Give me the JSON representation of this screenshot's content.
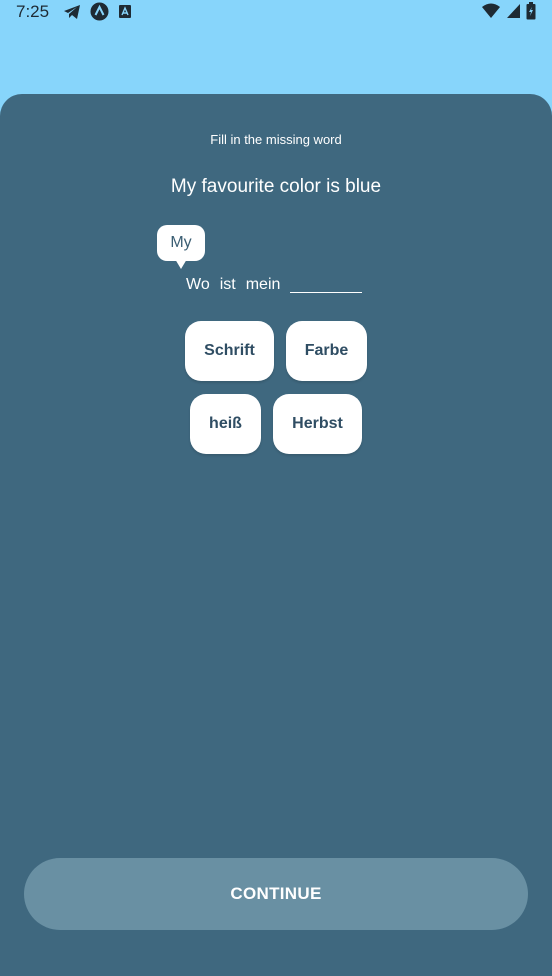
{
  "status_bar": {
    "time": "7:25",
    "left_icons": [
      "telegram-icon",
      "app-a-circle-icon",
      "app-a-square-icon"
    ],
    "right_icons": [
      "wifi-icon",
      "signal-icon",
      "battery-icon"
    ]
  },
  "exercise": {
    "instruction": "Fill in the missing word",
    "source_sentence": "My favourite color is blue",
    "hint": "My",
    "target_words": [
      "Wo",
      "ist",
      "mein"
    ]
  },
  "options": [
    {
      "label": "Schrift"
    },
    {
      "label": "Farbe"
    },
    {
      "label": "heiß"
    },
    {
      "label": "Herbst"
    }
  ],
  "footer": {
    "continue_label": "CONTINUE"
  },
  "colors": {
    "background_top": "#87d5fb",
    "sheet": "#3f687f",
    "option_bg": "#ffffff",
    "option_text": "#2f4d63",
    "continue_bg": "#6990a3"
  }
}
